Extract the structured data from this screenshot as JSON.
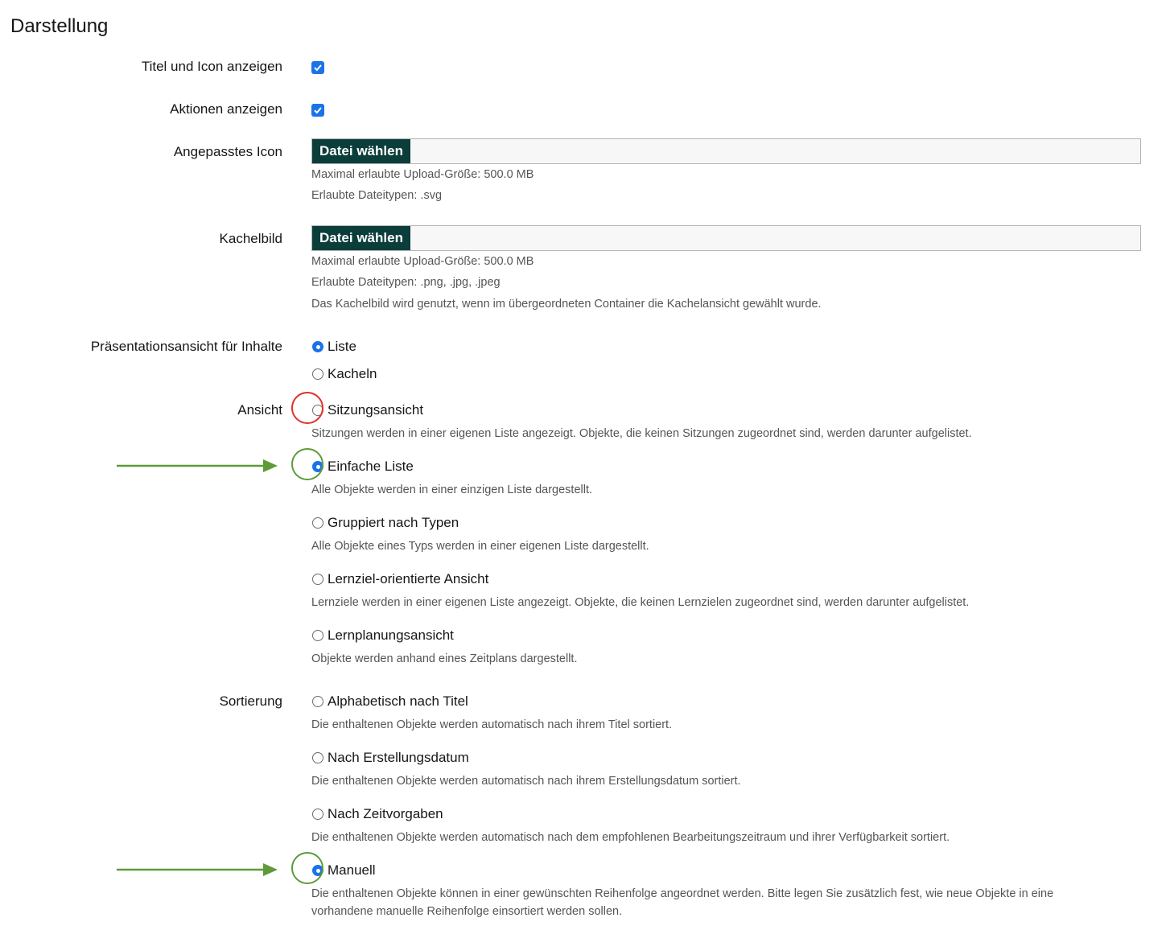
{
  "section_title": "Darstellung",
  "fields": {
    "show_title": {
      "label": "Titel und Icon anzeigen",
      "checked": true
    },
    "show_actions": {
      "label": "Aktionen anzeigen",
      "checked": true
    },
    "custom_icon": {
      "label": "Angepasstes Icon",
      "button": "Datei wählen",
      "help": [
        "Maximal erlaubte Upload-Größe: 500.0 MB",
        "Erlaubte Dateitypen: .svg"
      ]
    },
    "tile_image": {
      "label": "Kachelbild",
      "button": "Datei wählen",
      "help": [
        "Maximal erlaubte Upload-Größe: 500.0 MB",
        "Erlaubte Dateitypen: .png, .jpg, .jpeg",
        "Das Kachelbild wird genutzt, wenn im übergeordneten Container die Kachelansicht gewählt wurde."
      ]
    },
    "presentation": {
      "label": "Präsentationsansicht für Inhalte",
      "options": [
        {
          "label": "Liste",
          "checked": true
        },
        {
          "label": "Kacheln",
          "checked": false
        }
      ]
    },
    "view": {
      "label": "Ansicht",
      "options": [
        {
          "label": "Sitzungsansicht",
          "checked": false,
          "help": "Sitzungen werden in einer eigenen Liste angezeigt. Objekte, die keinen Sitzungen zugeordnet sind, werden darunter aufgelistet."
        },
        {
          "label": "Einfache Liste",
          "checked": true,
          "help": "Alle Objekte werden in einer einzigen Liste dargestellt."
        },
        {
          "label": "Gruppiert nach Typen",
          "checked": false,
          "help": "Alle Objekte eines Typs werden in einer eigenen Liste dargestellt."
        },
        {
          "label": "Lernziel-orientierte Ansicht",
          "checked": false,
          "help": "Lernziele werden in einer eigenen Liste angezeigt. Objekte, die keinen Lernzielen zugeordnet sind, werden darunter aufgelistet."
        },
        {
          "label": "Lernplanungsansicht",
          "checked": false,
          "help": "Objekte werden anhand eines Zeitplans dargestellt."
        }
      ]
    },
    "sorting": {
      "label": "Sortierung",
      "options": [
        {
          "label": "Alphabetisch nach Titel",
          "checked": false,
          "help": "Die enthaltenen Objekte werden automatisch nach ihrem Titel sortiert."
        },
        {
          "label": "Nach Erstellungsdatum",
          "checked": false,
          "help": "Die enthaltenen Objekte werden automatisch nach ihrem Erstellungsdatum sortiert."
        },
        {
          "label": "Nach Zeitvorgaben",
          "checked": false,
          "help": "Die enthaltenen Objekte werden automatisch nach dem empfohlenen Bearbeitungszeitraum und ihrer Verfügbarkeit sortiert."
        },
        {
          "label": "Manuell",
          "checked": true,
          "help": "Die enthaltenen Objekte können in einer gewünschten Reihenfolge angeordnet werden. Bitte legen Sie zusätzlich fest, wie neue Objekte in eine",
          "help2": "vorhandene manuelle Reihenfolge einsortiert werden sollen."
        }
      ]
    }
  },
  "annotations": {
    "red_color": "#e0312a",
    "green_color": "#5e9a3a"
  }
}
